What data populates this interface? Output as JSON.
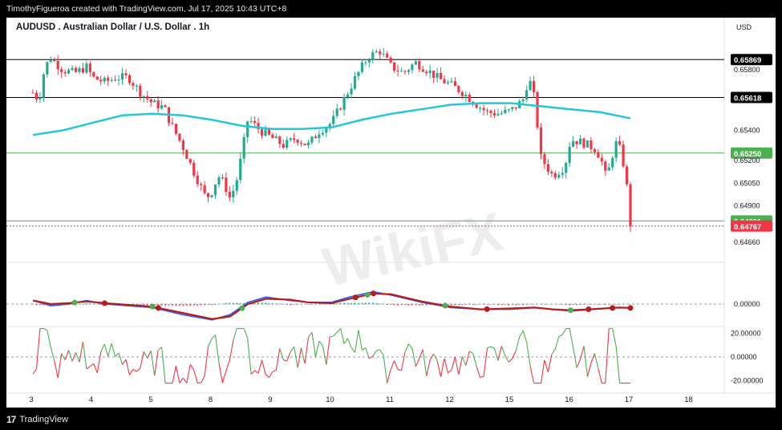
{
  "header": {
    "credit": "TimothyFigueroa created with TradingView.com, Jul 17, 2025 10:43 UTC+8"
  },
  "chart": {
    "title": "AUDUSD . Australian Dollar / U.S. Dollar . 1h",
    "currency": "USD"
  },
  "footer": {
    "brand": "TradingView"
  },
  "watermark": "WikiFX",
  "colors": {
    "up": "#22ab94",
    "down": "#f23645",
    "ma": "#26c6da",
    "macd": "#2962ff",
    "signal_up": "#4caf50",
    "signal_down": "#b71c1c"
  },
  "chart_data": [
    {
      "type": "candlestick",
      "title": "AUDUSD . Australian Dollar / U.S. Dollar . 1h",
      "ylim": [
        0.6458,
        0.6604
      ],
      "y_ticks": [
        "0.65800",
        "0.65400",
        "0.65200",
        "0.65050",
        "0.64900",
        "0.64660"
      ],
      "x_ticks": [
        "3",
        "4",
        "5",
        "8",
        "9",
        "10",
        "11",
        "12",
        "15",
        "16",
        "17",
        "18"
      ],
      "horizontal_levels": [
        {
          "label": "0.65869",
          "value": 0.65869,
          "color": "#000000"
        },
        {
          "label": "0.65618",
          "value": 0.65618,
          "color": "#000000"
        },
        {
          "label": "0.65250",
          "value": 0.6525,
          "color": "#4caf50"
        },
        {
          "label": "0.64801",
          "value": 0.64801,
          "color": "#4caf50"
        },
        {
          "label": "0.64767",
          "value": 0.64767,
          "color": "#f23645"
        }
      ],
      "close_path": [
        [
          3.0,
          0.6565
        ],
        [
          3.1,
          0.656
        ],
        [
          3.2,
          0.6582
        ],
        [
          3.3,
          0.6588
        ],
        [
          3.5,
          0.658
        ],
        [
          3.7,
          0.6578
        ],
        [
          3.9,
          0.6582
        ],
        [
          4.0,
          0.6575
        ],
        [
          4.2,
          0.6572
        ],
        [
          4.4,
          0.6575
        ],
        [
          4.6,
          0.6575
        ],
        [
          4.8,
          0.6565
        ],
        [
          5.0,
          0.6558
        ],
        [
          5.2,
          0.6555
        ],
        [
          5.3,
          0.6545
        ],
        [
          5.5,
          0.653
        ],
        [
          5.7,
          0.6512
        ],
        [
          5.9,
          0.6495
        ],
        [
          6.0,
          0.65
        ],
        [
          6.1,
          0.651
        ],
        [
          6.2,
          0.6505
        ],
        [
          6.3,
          0.6495
        ],
        [
          6.4,
          0.6505
        ],
        [
          6.5,
          0.6525
        ],
        [
          6.6,
          0.6548
        ],
        [
          6.8,
          0.654
        ],
        [
          7.0,
          0.6535
        ],
        [
          7.2,
          0.653
        ],
        [
          7.4,
          0.6535
        ],
        [
          7.6,
          0.653
        ],
        [
          7.8,
          0.654
        ],
        [
          8.0,
          0.6545
        ],
        [
          8.2,
          0.656
        ],
        [
          8.4,
          0.6575
        ],
        [
          8.6,
          0.6588
        ],
        [
          8.8,
          0.6593
        ],
        [
          9.0,
          0.6582
        ],
        [
          9.2,
          0.6578
        ],
        [
          9.4,
          0.6585
        ],
        [
          9.6,
          0.658
        ],
        [
          9.8,
          0.6574
        ],
        [
          10.0,
          0.657
        ],
        [
          10.2,
          0.6565
        ],
        [
          10.4,
          0.6558
        ],
        [
          10.6,
          0.6552
        ],
        [
          10.8,
          0.6551
        ],
        [
          11.0,
          0.6553
        ],
        [
          11.2,
          0.656
        ],
        [
          11.3,
          0.6575
        ],
        [
          11.4,
          0.656
        ],
        [
          11.5,
          0.6522
        ],
        [
          11.7,
          0.651
        ],
        [
          11.9,
          0.6516
        ],
        [
          12.0,
          0.6534
        ],
        [
          12.2,
          0.6532
        ],
        [
          12.4,
          0.6528
        ],
        [
          12.5,
          0.6522
        ],
        [
          12.6,
          0.6508
        ],
        [
          12.75,
          0.6532
        ],
        [
          12.85,
          0.6526
        ],
        [
          12.95,
          0.65
        ],
        [
          13.0,
          0.6478
        ]
      ],
      "moving_average": [
        [
          3.0,
          0.6537
        ],
        [
          3.5,
          0.654
        ],
        [
          4.0,
          0.6545
        ],
        [
          4.5,
          0.655
        ],
        [
          5.0,
          0.6551
        ],
        [
          5.5,
          0.655
        ],
        [
          6.0,
          0.6547
        ],
        [
          6.5,
          0.6543
        ],
        [
          7.0,
          0.6541
        ],
        [
          7.5,
          0.6541
        ],
        [
          8.0,
          0.6542
        ],
        [
          8.5,
          0.6547
        ],
        [
          9.0,
          0.6551
        ],
        [
          9.5,
          0.6554
        ],
        [
          10.0,
          0.6557
        ],
        [
          10.5,
          0.6558
        ],
        [
          11.0,
          0.6558
        ],
        [
          11.5,
          0.6556
        ],
        [
          12.0,
          0.6554
        ],
        [
          12.5,
          0.6552
        ],
        [
          13.0,
          0.6548
        ]
      ]
    },
    {
      "type": "macd",
      "zero_label": "0.00000",
      "macd": [
        [
          3.0,
          0.2
        ],
        [
          3.3,
          -0.1
        ],
        [
          3.6,
          0.0
        ],
        [
          3.9,
          0.2
        ],
        [
          4.2,
          0.0
        ],
        [
          4.6,
          -0.1
        ],
        [
          5.0,
          -0.2
        ],
        [
          5.5,
          -0.6
        ],
        [
          6.0,
          -0.9
        ],
        [
          6.3,
          -0.6
        ],
        [
          6.6,
          0.1
        ],
        [
          6.9,
          0.4
        ],
        [
          7.3,
          0.2
        ],
        [
          7.6,
          0.1
        ],
        [
          8.0,
          0.1
        ],
        [
          8.3,
          0.4
        ],
        [
          8.7,
          0.7
        ],
        [
          9.0,
          0.5
        ],
        [
          9.5,
          0.1
        ],
        [
          10.0,
          -0.2
        ],
        [
          10.5,
          -0.3
        ],
        [
          11.0,
          -0.3
        ],
        [
          11.4,
          -0.2
        ],
        [
          11.7,
          -0.3
        ],
        [
          12.0,
          -0.4
        ],
        [
          12.4,
          -0.3
        ],
        [
          12.8,
          -0.2
        ],
        [
          13.0,
          -0.2
        ]
      ],
      "signal": [
        [
          3.0,
          0.2
        ],
        [
          3.3,
          0.0
        ],
        [
          3.6,
          0.05
        ],
        [
          3.9,
          0.15
        ],
        [
          4.2,
          0.05
        ],
        [
          4.6,
          -0.05
        ],
        [
          5.0,
          -0.15
        ],
        [
          5.5,
          -0.5
        ],
        [
          6.0,
          -0.85
        ],
        [
          6.3,
          -0.7
        ],
        [
          6.6,
          0.0
        ],
        [
          6.9,
          0.3
        ],
        [
          7.3,
          0.25
        ],
        [
          7.6,
          0.1
        ],
        [
          8.0,
          0.05
        ],
        [
          8.3,
          0.3
        ],
        [
          8.7,
          0.6
        ],
        [
          9.0,
          0.55
        ],
        [
          9.5,
          0.15
        ],
        [
          10.0,
          -0.15
        ],
        [
          10.5,
          -0.3
        ],
        [
          11.0,
          -0.25
        ],
        [
          11.4,
          -0.2
        ],
        [
          11.7,
          -0.3
        ],
        [
          12.0,
          -0.35
        ],
        [
          12.4,
          -0.28
        ],
        [
          12.8,
          -0.2
        ],
        [
          13.0,
          -0.22
        ]
      ]
    },
    {
      "type": "line",
      "name": "oscillator",
      "y_ticks": [
        "20.00000",
        "0.00000",
        "-20.00000"
      ],
      "ylim": [
        -25,
        30
      ]
    }
  ]
}
